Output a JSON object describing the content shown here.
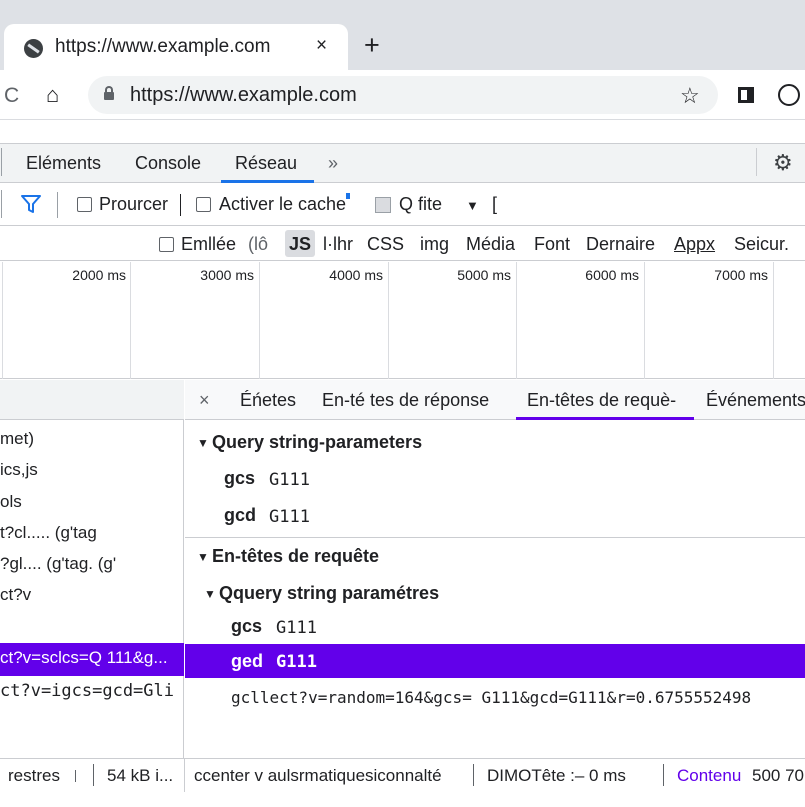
{
  "browser": {
    "tab_title": "https://www.example.com",
    "tab_close": "×",
    "new_tab": "+",
    "url": "https://www.example.com",
    "reload_glyph": "C",
    "home_glyph": "⌂",
    "star_glyph": "☆",
    "icons": [
      "globe-icon",
      "close-icon",
      "plus-icon",
      "reload-icon",
      "home-icon",
      "lock-icon",
      "star-icon",
      "extension-icon",
      "account-icon"
    ]
  },
  "devtools": {
    "tabs": [
      "Eléments",
      "Console",
      "Réseau",
      "»"
    ],
    "active_tab": "Réseau",
    "accent_color": "#1a73e8",
    "filter_bar": {
      "preserve_log": "Prourcer",
      "disable_cache": "Activer le cache",
      "throttle": "Q fite",
      "dropdown_glyph": "▼",
      "trailing": "["
    },
    "types": {
      "hide_data": "Emllée",
      "all": "(lô",
      "items": [
        "JS",
        "l·lhr",
        "CSS",
        "img",
        "Média",
        "Font",
        "Dernaire",
        "Appx",
        "Seicur."
      ],
      "selected": "JS"
    },
    "timeline": {
      "labels": [
        "2000 ms",
        "3000 ms",
        "4000 ms",
        "5000 ms",
        "6000 ms",
        "7000 ms"
      ]
    },
    "requests": {
      "rows": [
        "met)",
        "ics,js",
        "ols",
        "t?cl..... (g'tag",
        "?gl.... (g'tag. (g'",
        "ct?v",
        "",
        "ct?v=sclcs=Q 111&g...",
        "ct?v=igcs=gcd=Gli"
      ],
      "selected_index": 7
    },
    "details": {
      "close": "×",
      "tabs": [
        "Éńetes",
        "En-té tes de réponse",
        "En-têtes de requè-",
        "Événements"
      ],
      "active_tab": "En-têtes de requè-",
      "selection_color": "#6200ea",
      "section1": {
        "title": "Query string-parameters",
        "params": [
          {
            "key": "gcs",
            "value": "G111"
          },
          {
            "key": "gcd",
            "value": "G111"
          }
        ]
      },
      "section2": {
        "title": "En-têtes de requête",
        "sub_title": "Qquery string paramétres",
        "params": [
          {
            "key": "gcs",
            "value": "G111"
          },
          {
            "key": "ged",
            "value": "G111"
          }
        ],
        "selected_index": 1,
        "raw_url": "gcllect?v=random=164&gcs= G111&gcd=G111&r=0.6755552498"
      }
    },
    "status": {
      "left1": "restres",
      "left2": "54 kB i...",
      "center": "ccenter v aulsrmatiquesiconnalté",
      "dom": "DIMOTête :– 0 ms",
      "content": "Contenu",
      "right": "500 70"
    }
  }
}
